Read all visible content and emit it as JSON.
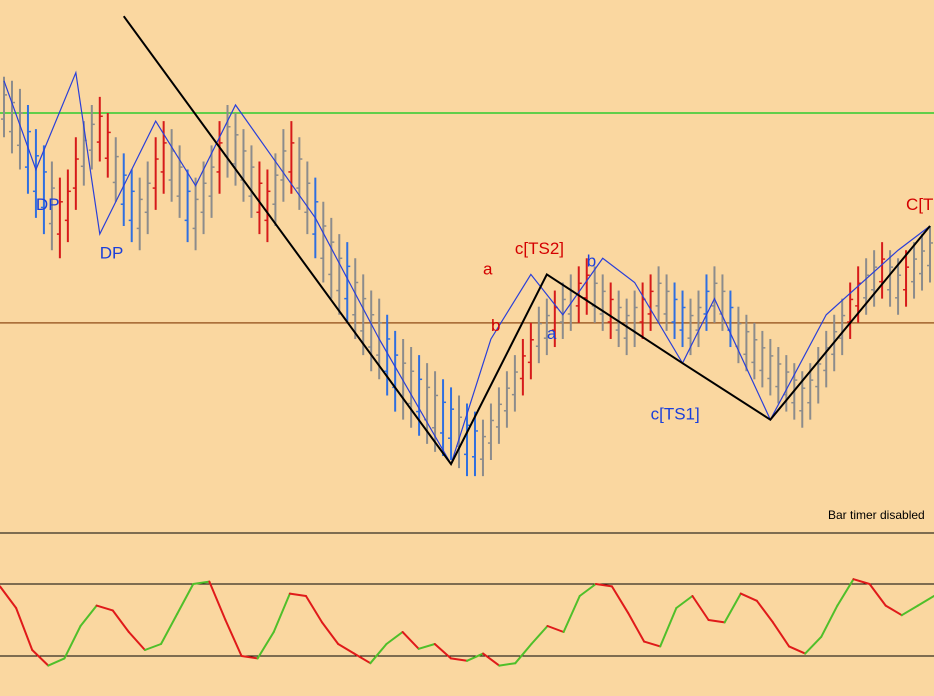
{
  "chart_data": [
    {
      "type": "line",
      "panel": "price",
      "title": "",
      "xlabel": "",
      "ylabel": "",
      "grid": false,
      "x": [
        0,
        1,
        2,
        3,
        4,
        5,
        6,
        7,
        8,
        9,
        10,
        11,
        12,
        13,
        14,
        15,
        16,
        17,
        18,
        19,
        20,
        21,
        22,
        23,
        24,
        25,
        26,
        27,
        28,
        29,
        30,
        31,
        32,
        33,
        34,
        35,
        36,
        37,
        38,
        39,
        40,
        41,
        42,
        43,
        44,
        45,
        46,
        47,
        48,
        49,
        50,
        51,
        52,
        53,
        54,
        55,
        56,
        57,
        58,
        59,
        60,
        61,
        62,
        63,
        64,
        65,
        66,
        67,
        68,
        69,
        70,
        71,
        72,
        73,
        74,
        75,
        76,
        77,
        78,
        79,
        80,
        81,
        82,
        83,
        84,
        85,
        86,
        87,
        88,
        89,
        90,
        91,
        92,
        93,
        94,
        95,
        96,
        97,
        98,
        99,
        100,
        101,
        102,
        103,
        104,
        105,
        106,
        107,
        108,
        109,
        110,
        111,
        112,
        113,
        114,
        115,
        116
      ],
      "ylim": [
        0,
        100
      ],
      "bars": {
        "high": [
          95,
          94,
          92,
          88,
          82,
          78,
          74,
          70,
          72,
          80,
          84,
          88,
          90,
          86,
          80,
          76,
          72,
          70,
          74,
          80,
          84,
          82,
          78,
          72,
          70,
          74,
          78,
          84,
          88,
          86,
          82,
          78,
          74,
          72,
          76,
          82,
          84,
          80,
          74,
          70,
          64,
          60,
          56,
          54,
          50,
          46,
          42,
          40,
          36,
          32,
          30,
          28,
          26,
          24,
          22,
          20,
          18,
          16,
          14,
          12,
          10,
          14,
          18,
          22,
          26,
          30,
          34,
          38,
          40,
          42,
          44,
          46,
          48,
          50,
          48,
          46,
          44,
          42,
          40,
          42,
          44,
          46,
          48,
          46,
          44,
          42,
          40,
          42,
          46,
          48,
          46,
          42,
          38,
          36,
          34,
          32,
          30,
          28,
          26,
          24,
          22,
          24,
          28,
          32,
          36,
          40,
          44,
          48,
          50,
          52,
          54,
          52,
          50,
          52,
          54,
          56,
          58
        ],
        "low": [
          80,
          76,
          72,
          66,
          60,
          56,
          52,
          50,
          54,
          62,
          68,
          72,
          74,
          70,
          64,
          58,
          54,
          52,
          56,
          62,
          66,
          64,
          60,
          54,
          52,
          56,
          60,
          66,
          70,
          68,
          64,
          60,
          56,
          54,
          58,
          64,
          66,
          62,
          56,
          50,
          44,
          40,
          36,
          34,
          30,
          26,
          22,
          20,
          16,
          12,
          10,
          8,
          6,
          4,
          2,
          1,
          0,
          -2,
          -4,
          -4,
          -4,
          0,
          4,
          8,
          12,
          16,
          20,
          24,
          26,
          28,
          30,
          32,
          34,
          36,
          34,
          32,
          30,
          28,
          26,
          28,
          30,
          32,
          34,
          32,
          30,
          28,
          26,
          28,
          32,
          34,
          32,
          28,
          24,
          22,
          20,
          18,
          16,
          14,
          12,
          10,
          8,
          10,
          14,
          18,
          22,
          26,
          30,
          34,
          36,
          38,
          40,
          38,
          36,
          38,
          40,
          42,
          44
        ],
        "color": [
          "gray",
          "gray",
          "gray",
          "blue",
          "blue",
          "blue",
          "gray",
          "red",
          "red",
          "red",
          "gray",
          "gray",
          "red",
          "red",
          "gray",
          "blue",
          "blue",
          "gray",
          "gray",
          "red",
          "red",
          "gray",
          "gray",
          "blue",
          "gray",
          "gray",
          "gray",
          "red",
          "gray",
          "gray",
          "gray",
          "gray",
          "red",
          "red",
          "gray",
          "gray",
          "red",
          "gray",
          "gray",
          "blue",
          "gray",
          "gray",
          "gray",
          "blue",
          "gray",
          "gray",
          "gray",
          "gray",
          "blue",
          "blue",
          "gray",
          "gray",
          "blue",
          "gray",
          "gray",
          "blue",
          "blue",
          "gray",
          "blue",
          "blue",
          "gray",
          "gray",
          "gray",
          "gray",
          "gray",
          "red",
          "red",
          "gray",
          "gray",
          "red",
          "gray",
          "gray",
          "red",
          "red",
          "gray",
          "gray",
          "red",
          "gray",
          "gray",
          "gray",
          "red",
          "red",
          "gray",
          "gray",
          "blue",
          "blue",
          "gray",
          "gray",
          "blue",
          "gray",
          "gray",
          "blue",
          "gray",
          "gray",
          "gray",
          "gray",
          "gray",
          "gray",
          "gray",
          "gray",
          "gray",
          "gray",
          "gray",
          "gray",
          "gray",
          "gray",
          "red",
          "red",
          "gray",
          "gray",
          "red",
          "gray",
          "gray",
          "red",
          "gray",
          "gray",
          "gray"
        ]
      },
      "zigzag_black": [
        [
          15,
          110
        ],
        [
          56,
          -1
        ],
        [
          68,
          46
        ],
        [
          85,
          24
        ],
        [
          96,
          10
        ],
        [
          116,
          58
        ]
      ],
      "zigzag_blue": [
        [
          0,
          94
        ],
        [
          4,
          72
        ],
        [
          9,
          96
        ],
        [
          12,
          56
        ],
        [
          19,
          84
        ],
        [
          24,
          68
        ],
        [
          29,
          88
        ],
        [
          34,
          74
        ],
        [
          39,
          60
        ],
        [
          47,
          30
        ],
        [
          56,
          -1
        ],
        [
          61,
          30
        ],
        [
          66,
          46
        ],
        [
          70,
          36
        ],
        [
          75,
          50
        ],
        [
          79,
          44
        ],
        [
          85,
          24
        ],
        [
          89,
          40
        ],
        [
          96,
          10
        ],
        [
          103,
          36
        ],
        [
          112,
          52
        ],
        [
          116,
          58
        ]
      ],
      "horizontal_lines": [
        {
          "y": 86,
          "color": "#2ECC2E"
        },
        {
          "y": 34,
          "color": "#A0622D"
        }
      ],
      "labels": [
        {
          "text": "DP",
          "x": 4,
          "y": 62,
          "color": "#1A3FDB"
        },
        {
          "text": "DP",
          "x": 12,
          "y": 50,
          "color": "#1A3FDB"
        },
        {
          "text": "c[TS2]",
          "x": 64,
          "y": 51,
          "color": "#D40000"
        },
        {
          "text": "a",
          "x": 60,
          "y": 46,
          "color": "#D40000"
        },
        {
          "text": "b",
          "x": 61,
          "y": 32,
          "color": "#D40000"
        },
        {
          "text": "b",
          "x": 73,
          "y": 48,
          "color": "#1A3FDB"
        },
        {
          "text": "a",
          "x": 68,
          "y": 30,
          "color": "#1A3FDB"
        },
        {
          "text": "c[TS1]",
          "x": 81,
          "y": 10,
          "color": "#1A3FDB"
        },
        {
          "text": "C[T",
          "x": 113,
          "y": 62,
          "color": "#D40000"
        }
      ]
    },
    {
      "type": "line",
      "panel": "oscillator",
      "title": "",
      "xlabel": "",
      "ylabel": "",
      "grid": false,
      "ylim": [
        0,
        100
      ],
      "levels": [
        80,
        20
      ],
      "x": [
        0,
        2,
        4,
        6,
        8,
        10,
        12,
        14,
        16,
        18,
        20,
        22,
        24,
        26,
        28,
        30,
        32,
        34,
        36,
        38,
        40,
        42,
        44,
        46,
        48,
        50,
        52,
        54,
        56,
        58,
        60,
        62,
        64,
        66,
        68,
        70,
        72,
        74,
        76,
        78,
        80,
        82,
        84,
        86,
        88,
        90,
        92,
        94,
        96,
        98,
        100,
        102,
        104,
        106,
        108,
        110,
        112,
        114,
        116
      ],
      "series": [
        {
          "values": [
            78,
            60,
            25,
            12,
            18,
            45,
            62,
            58,
            40,
            25,
            30,
            55,
            80,
            82,
            50,
            20,
            18,
            40,
            72,
            70,
            48,
            30,
            22,
            14,
            30,
            40,
            26,
            30,
            18,
            16,
            22,
            12,
            14,
            30,
            45,
            40,
            70,
            80,
            78,
            56,
            32,
            28,
            60,
            70,
            50,
            48,
            72,
            66,
            48,
            28,
            22,
            36,
            62,
            84,
            80,
            62,
            54,
            62,
            70
          ]
        }
      ]
    }
  ],
  "status": {
    "bar_timer": "Bar timer disabled"
  },
  "colors": {
    "background": "#FAD7A0",
    "up": "#2F6FE0",
    "down": "#D61A1A",
    "neutral": "#8C8C8C",
    "osc_up": "#4FBF2A",
    "osc_down": "#E01A1A"
  }
}
